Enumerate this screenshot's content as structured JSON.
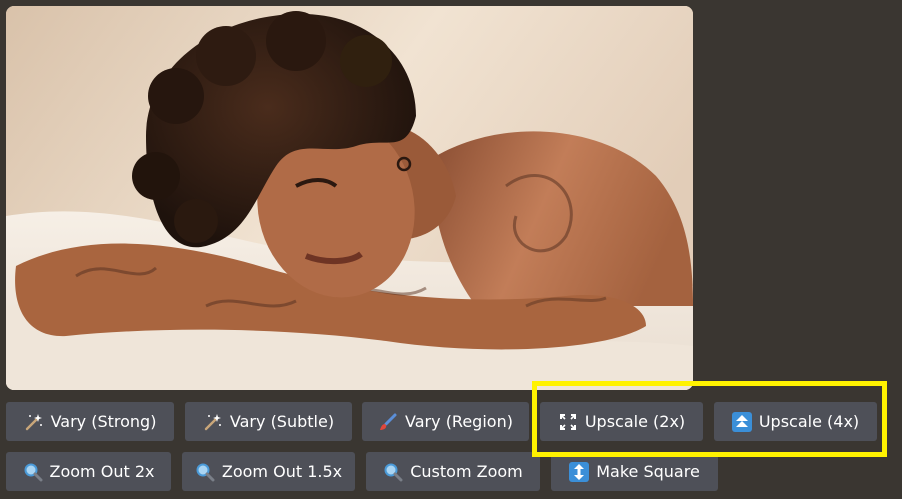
{
  "image": {
    "alt": "",
    "colors": {
      "background": "#ecdccb",
      "sheet": "#f4ede4",
      "skin": "#b5704e",
      "hair": "#2a1a12"
    }
  },
  "buttons": {
    "row1": [
      {
        "name": "vary-strong-button",
        "icon": "magic-wand-icon",
        "label": "Vary (Strong)"
      },
      {
        "name": "vary-subtle-button",
        "icon": "magic-wand-icon",
        "label": "Vary (Subtle)"
      },
      {
        "name": "vary-region-button",
        "icon": "paintbrush-icon",
        "label": "Vary (Region)"
      },
      {
        "name": "upscale-2x-button",
        "icon": "expand-corners-icon",
        "label": "Upscale (2x)"
      },
      {
        "name": "upscale-4x-button",
        "icon": "up-arrows-icon",
        "label": "Upscale (4x)"
      }
    ],
    "row2": [
      {
        "name": "zoom-out-2x-button",
        "icon": "magnifier-icon",
        "label": "Zoom Out 2x"
      },
      {
        "name": "zoom-out-1-5x-button",
        "icon": "magnifier-icon",
        "label": "Zoom Out 1.5x"
      },
      {
        "name": "custom-zoom-button",
        "icon": "magnifier-icon",
        "label": "Custom Zoom"
      },
      {
        "name": "make-square-button",
        "icon": "up-down-arrow-icon",
        "label": "Make Square"
      }
    ]
  },
  "highlight": {
    "color": "#fff200",
    "target": "upscale-buttons"
  }
}
